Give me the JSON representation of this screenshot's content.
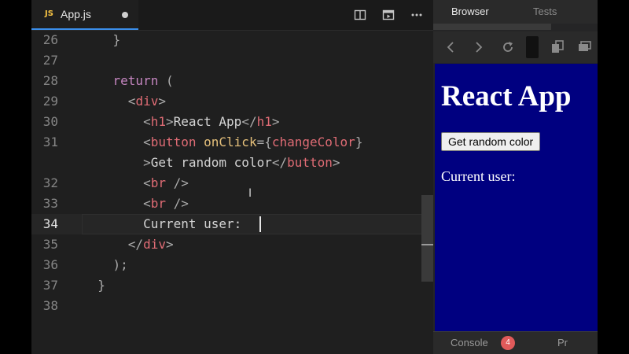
{
  "editor": {
    "tab": {
      "icon": "JS",
      "filename": "App.js"
    },
    "actions": [
      "split-editor-icon",
      "preview-icon",
      "more-icon"
    ],
    "lines": [
      {
        "num": "26",
        "tokens": [
          {
            "t": "    ",
            "c": "txt"
          },
          {
            "t": "}",
            "c": "br"
          }
        ]
      },
      {
        "num": "27",
        "tokens": []
      },
      {
        "num": "28",
        "tokens": [
          {
            "t": "    ",
            "c": "txt"
          },
          {
            "t": "return",
            "c": "kw"
          },
          {
            "t": " (",
            "c": "br"
          }
        ]
      },
      {
        "num": "29",
        "tokens": [
          {
            "t": "      ",
            "c": "txt"
          },
          {
            "t": "<",
            "c": "br"
          },
          {
            "t": "div",
            "c": "tag"
          },
          {
            "t": ">",
            "c": "br"
          }
        ]
      },
      {
        "num": "30",
        "tokens": [
          {
            "t": "        ",
            "c": "txt"
          },
          {
            "t": "<",
            "c": "br"
          },
          {
            "t": "h1",
            "c": "tag"
          },
          {
            "t": ">",
            "c": "br"
          },
          {
            "t": "React App",
            "c": "txt"
          },
          {
            "t": "</",
            "c": "br"
          },
          {
            "t": "h1",
            "c": "tag"
          },
          {
            "t": ">",
            "c": "br"
          }
        ]
      },
      {
        "num": "31",
        "tokens": [
          {
            "t": "        ",
            "c": "txt"
          },
          {
            "t": "<",
            "c": "br"
          },
          {
            "t": "button",
            "c": "tag"
          },
          {
            "t": " ",
            "c": "txt"
          },
          {
            "t": "onClick",
            "c": "attr"
          },
          {
            "t": "={",
            "c": "br"
          },
          {
            "t": "changeColor",
            "c": "tag"
          },
          {
            "t": "}",
            "c": "br"
          }
        ]
      },
      {
        "num": "",
        "tokens": [
          {
            "t": "        ",
            "c": "txt"
          },
          {
            "t": ">",
            "c": "br"
          },
          {
            "t": "Get random color",
            "c": "txt"
          },
          {
            "t": "</",
            "c": "br"
          },
          {
            "t": "button",
            "c": "tag"
          },
          {
            "t": ">",
            "c": "br"
          }
        ]
      },
      {
        "num": "32",
        "tokens": [
          {
            "t": "        ",
            "c": "txt"
          },
          {
            "t": "<",
            "c": "br"
          },
          {
            "t": "br",
            "c": "tag"
          },
          {
            "t": " />",
            "c": "br"
          }
        ]
      },
      {
        "num": "33",
        "tokens": [
          {
            "t": "        ",
            "c": "txt"
          },
          {
            "t": "<",
            "c": "br"
          },
          {
            "t": "br",
            "c": "tag"
          },
          {
            "t": " />",
            "c": "br"
          }
        ]
      },
      {
        "num": "34",
        "tokens": [
          {
            "t": "        ",
            "c": "txt"
          },
          {
            "t": "Current user: ",
            "c": "txt"
          }
        ],
        "current": true
      },
      {
        "num": "35",
        "tokens": [
          {
            "t": "      ",
            "c": "txt"
          },
          {
            "t": "</",
            "c": "br"
          },
          {
            "t": "div",
            "c": "tag"
          },
          {
            "t": ">",
            "c": "br"
          }
        ]
      },
      {
        "num": "36",
        "tokens": [
          {
            "t": "    ",
            "c": "txt"
          },
          {
            "t": ");",
            "c": "br"
          }
        ]
      },
      {
        "num": "37",
        "tokens": [
          {
            "t": "  ",
            "c": "txt"
          },
          {
            "t": "}",
            "c": "br"
          }
        ]
      },
      {
        "num": "38",
        "tokens": []
      }
    ]
  },
  "panel": {
    "tabs": {
      "browser": "Browser",
      "tests": "Tests"
    },
    "toolbar": [
      "back-icon",
      "forward-icon",
      "reload-icon",
      "copy-icon",
      "windows-icon"
    ],
    "viewport": {
      "heading": "React App",
      "button": "Get random color",
      "user_label": "Current user:",
      "background": "#000080"
    },
    "bottom": {
      "console": "Console",
      "console_badge": "4",
      "problems": "Pr"
    }
  }
}
